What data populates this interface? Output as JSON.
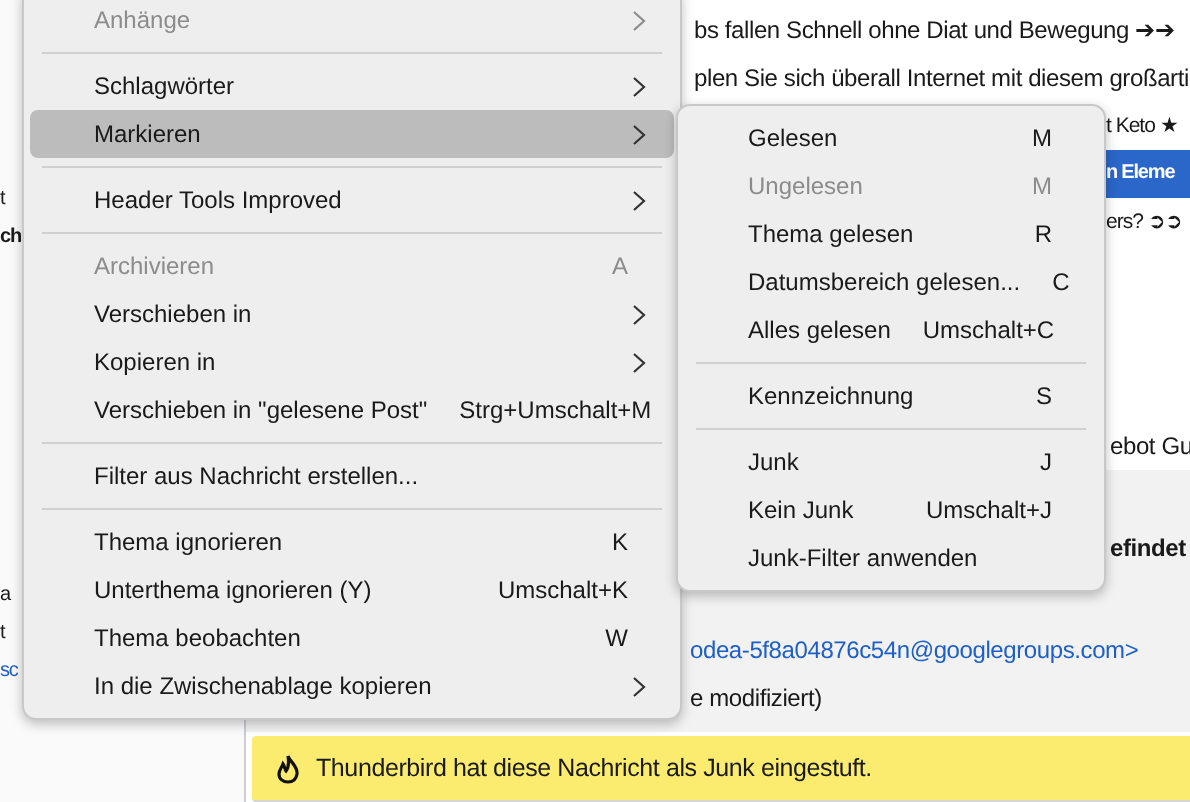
{
  "background": {
    "folder_fragments": [
      {
        "text": "t",
        "kind": "text"
      },
      {
        "text": "ch",
        "kind": "bold"
      },
      {
        "text": "a",
        "kind": "text"
      },
      {
        "text": "t",
        "kind": "text"
      },
      {
        "text": "sc",
        "kind": "link"
      }
    ],
    "message_rows": [
      {
        "subject": "bs fallen Schnell ohne Diat und Bewegung ➔➔",
        "selected": false
      },
      {
        "subject": "plen Sie sich überall Internet mit diesem großarti",
        "selected": false
      },
      {
        "subject": "t Keto ★",
        "selected": false
      },
      {
        "subject": "n Eleme",
        "selected": true
      },
      {
        "subject": "ers? ➲➲",
        "selected": false
      }
    ],
    "preview_line": "ebot  Gu",
    "header_lines": [
      {
        "text": "efindet",
        "kind": "bold"
      },
      {
        "text": "odea-5f8a04876c54n@googlegroups.com>",
        "kind": "link"
      },
      {
        "text": "e modifiziert)",
        "kind": "text"
      }
    ],
    "junk_bar": {
      "message": "Thunderbird hat diese Nachricht als Junk eingestuft."
    }
  },
  "context_menu": {
    "items": [
      {
        "kind": "item",
        "label": "Anhänge",
        "submenu": true,
        "disabled": true,
        "selected": false
      },
      {
        "kind": "separator"
      },
      {
        "kind": "item",
        "label": "Schlagwörter",
        "submenu": true,
        "disabled": false,
        "selected": false
      },
      {
        "kind": "item",
        "label": "Markieren",
        "submenu": true,
        "disabled": false,
        "selected": true
      },
      {
        "kind": "separator"
      },
      {
        "kind": "item",
        "label": "Header Tools Improved",
        "submenu": true,
        "disabled": false,
        "selected": false
      },
      {
        "kind": "separator"
      },
      {
        "kind": "item",
        "label": "Archivieren",
        "shortcut": "A",
        "submenu": false,
        "disabled": true,
        "selected": false
      },
      {
        "kind": "item",
        "label": "Verschieben in",
        "submenu": true,
        "disabled": false,
        "selected": false
      },
      {
        "kind": "item",
        "label": "Kopieren in",
        "submenu": true,
        "disabled": false,
        "selected": false
      },
      {
        "kind": "item",
        "label": "Verschieben in \"gelesene Post\"",
        "shortcut": "Strg+Umschalt+M",
        "submenu": false,
        "disabled": false,
        "selected": false
      },
      {
        "kind": "separator"
      },
      {
        "kind": "item",
        "label": "Filter aus Nachricht erstellen...",
        "submenu": false,
        "disabled": false,
        "selected": false
      },
      {
        "kind": "separator"
      },
      {
        "kind": "item",
        "label": "Thema ignorieren",
        "shortcut": "K",
        "submenu": false,
        "disabled": false,
        "selected": false
      },
      {
        "kind": "item",
        "label": "Unterthema ignorieren (Y)",
        "shortcut": "Umschalt+K",
        "submenu": false,
        "disabled": false,
        "selected": false
      },
      {
        "kind": "item",
        "label": "Thema beobachten",
        "shortcut": "W",
        "submenu": false,
        "disabled": false,
        "selected": false
      },
      {
        "kind": "item",
        "label": "In die Zwischenablage kopieren",
        "submenu": true,
        "disabled": false,
        "selected": false
      }
    ]
  },
  "mark_submenu": {
    "items": [
      {
        "kind": "item",
        "label": "Gelesen",
        "shortcut": "M",
        "submenu": false,
        "disabled": false,
        "selected": false
      },
      {
        "kind": "item",
        "label": "Ungelesen",
        "shortcut": "M",
        "submenu": false,
        "disabled": true,
        "selected": false
      },
      {
        "kind": "item",
        "label": "Thema gelesen",
        "shortcut": "R",
        "submenu": false,
        "disabled": false,
        "selected": false
      },
      {
        "kind": "item",
        "label": "Datumsbereich gelesen...",
        "shortcut": "C",
        "submenu": false,
        "disabled": false,
        "selected": false
      },
      {
        "kind": "item",
        "label": "Alles gelesen",
        "shortcut": "Umschalt+C",
        "submenu": false,
        "disabled": false,
        "selected": false
      },
      {
        "kind": "separator"
      },
      {
        "kind": "item",
        "label": "Kennzeichnung",
        "shortcut": "S",
        "submenu": false,
        "disabled": false,
        "selected": false
      },
      {
        "kind": "separator"
      },
      {
        "kind": "item",
        "label": "Junk",
        "shortcut": "J",
        "submenu": false,
        "disabled": false,
        "selected": false
      },
      {
        "kind": "item",
        "label": "Kein Junk",
        "shortcut": "Umschalt+J",
        "submenu": false,
        "disabled": false,
        "selected": false
      },
      {
        "kind": "item",
        "label": "Junk-Filter anwenden",
        "submenu": false,
        "disabled": false,
        "selected": false
      }
    ]
  }
}
